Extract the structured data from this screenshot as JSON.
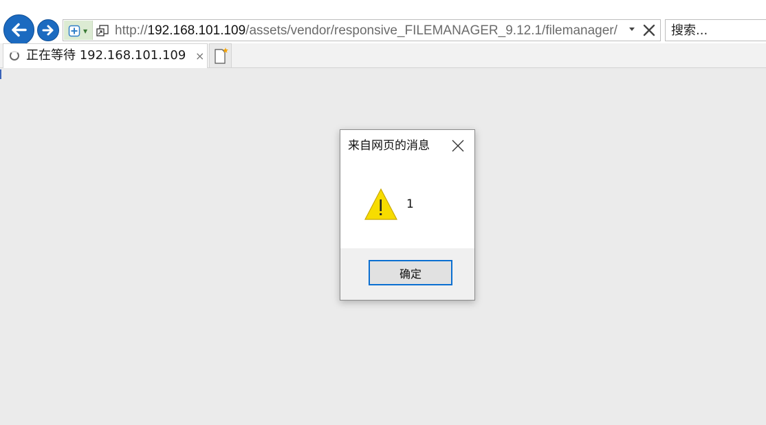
{
  "toolbar": {
    "back_icon": "arrow-left-icon",
    "forward_icon": "arrow-right-icon",
    "compat_icon": "compatibility-view-icon",
    "url_prefix": "http://",
    "url_host": "192.168.101.109",
    "url_path": "/assets/vendor/responsive_FILEMANAGER_9.12.1/filemanager/",
    "search_placeholder": "搜索..."
  },
  "tabs": [
    {
      "title": "正在等待 192.168.101.109",
      "close_label": "×",
      "loading": true
    }
  ],
  "dialog": {
    "title": "来自网页的消息",
    "message": "1",
    "ok_label": "确定",
    "icon": "warning-icon",
    "colors": {
      "button_border": "#0a6fd1",
      "warning_fill": "#f7dc00"
    }
  },
  "colors": {
    "nav_button": "#1b6ac0",
    "page_background": "#ebebeb"
  }
}
